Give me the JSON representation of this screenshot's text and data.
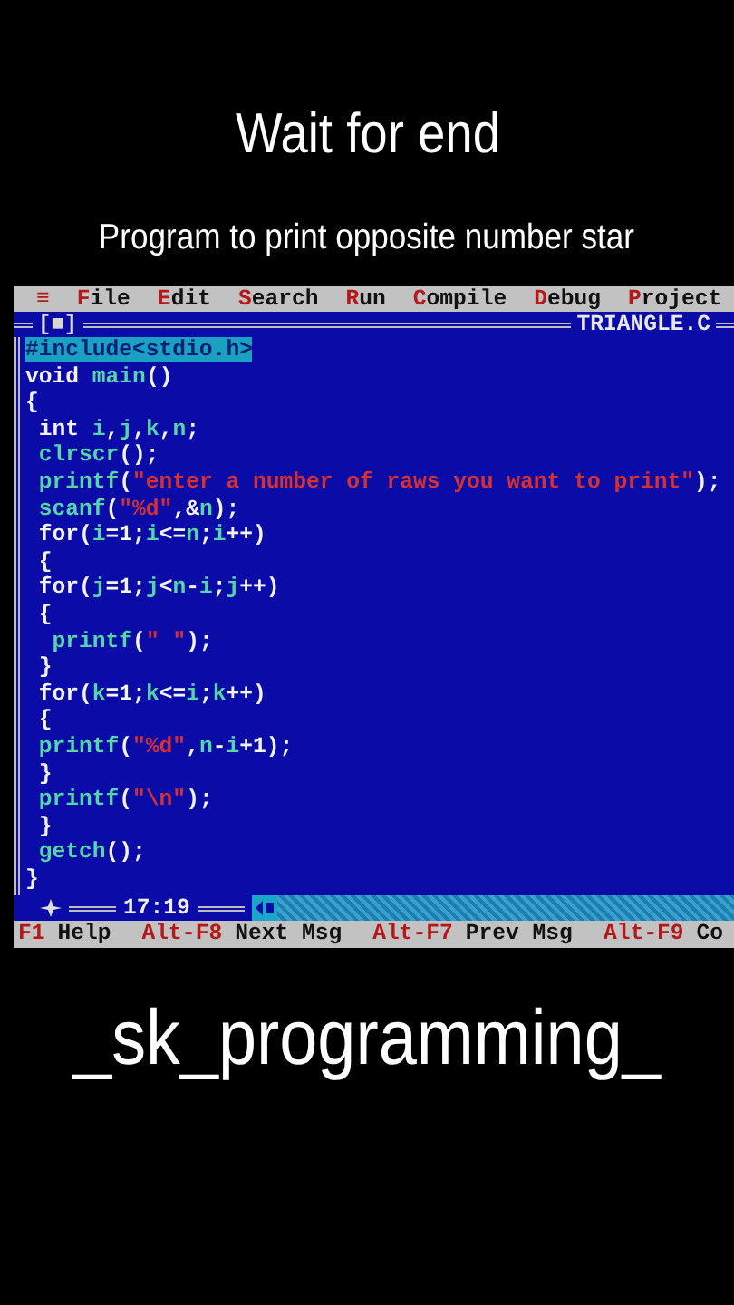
{
  "captions": {
    "heading": "Wait for end",
    "subheading": "Program to print opposite number star"
  },
  "menu": [
    {
      "label": "≡",
      "kind": "system"
    },
    {
      "label": "File",
      "kind": "menu"
    },
    {
      "label": "Edit",
      "kind": "menu"
    },
    {
      "label": "Search",
      "kind": "menu"
    },
    {
      "label": "Run",
      "kind": "menu"
    },
    {
      "label": "Compile",
      "kind": "menu"
    },
    {
      "label": "Debug",
      "kind": "menu"
    },
    {
      "label": "Project",
      "kind": "menu"
    }
  ],
  "editor": {
    "close_box": "[■]",
    "title": "TRIANGLE.C",
    "position": "17:19",
    "lines": [
      [
        {
          "kind": "directive",
          "text": "#include<stdio.h>"
        }
      ],
      [
        {
          "kind": "plain",
          "text": "void "
        },
        {
          "kind": "ident",
          "text": "main"
        },
        {
          "kind": "plain",
          "text": "()"
        }
      ],
      [
        {
          "kind": "plain",
          "text": "{"
        }
      ],
      [
        {
          "kind": "plain",
          "text": " int "
        },
        {
          "kind": "ident",
          "text": "i"
        },
        {
          "kind": "plain",
          "text": ","
        },
        {
          "kind": "ident",
          "text": "j"
        },
        {
          "kind": "plain",
          "text": ","
        },
        {
          "kind": "ident",
          "text": "k"
        },
        {
          "kind": "plain",
          "text": ","
        },
        {
          "kind": "ident",
          "text": "n"
        },
        {
          "kind": "plain",
          "text": ";"
        }
      ],
      [
        {
          "kind": "ident",
          "text": " clrscr"
        },
        {
          "kind": "plain",
          "text": "();"
        }
      ],
      [
        {
          "kind": "ident",
          "text": " printf"
        },
        {
          "kind": "plain",
          "text": "("
        },
        {
          "kind": "string",
          "text": "\"enter a number of raws you want to print\""
        },
        {
          "kind": "plain",
          "text": ");"
        }
      ],
      [
        {
          "kind": "ident",
          "text": " scanf"
        },
        {
          "kind": "plain",
          "text": "("
        },
        {
          "kind": "string",
          "text": "\"%d\""
        },
        {
          "kind": "plain",
          "text": ",&"
        },
        {
          "kind": "ident",
          "text": "n"
        },
        {
          "kind": "plain",
          "text": ");"
        }
      ],
      [
        {
          "kind": "plain",
          "text": " for("
        },
        {
          "kind": "ident",
          "text": "i"
        },
        {
          "kind": "plain",
          "text": "=1;"
        },
        {
          "kind": "ident",
          "text": "i"
        },
        {
          "kind": "plain",
          "text": "<="
        },
        {
          "kind": "ident",
          "text": "n"
        },
        {
          "kind": "plain",
          "text": ";"
        },
        {
          "kind": "ident",
          "text": "i"
        },
        {
          "kind": "plain",
          "text": "++)"
        }
      ],
      [
        {
          "kind": "plain",
          "text": " {"
        }
      ],
      [
        {
          "kind": "plain",
          "text": " for("
        },
        {
          "kind": "ident",
          "text": "j"
        },
        {
          "kind": "plain",
          "text": "=1;"
        },
        {
          "kind": "ident",
          "text": "j"
        },
        {
          "kind": "plain",
          "text": "<"
        },
        {
          "kind": "ident",
          "text": "n"
        },
        {
          "kind": "plain",
          "text": "-"
        },
        {
          "kind": "ident",
          "text": "i"
        },
        {
          "kind": "plain",
          "text": ";"
        },
        {
          "kind": "ident",
          "text": "j"
        },
        {
          "kind": "plain",
          "text": "++)"
        }
      ],
      [
        {
          "kind": "plain",
          "text": " {"
        }
      ],
      [
        {
          "kind": "ident",
          "text": "  printf"
        },
        {
          "kind": "plain",
          "text": "("
        },
        {
          "kind": "string",
          "text": "\" \""
        },
        {
          "kind": "plain",
          "text": ");"
        }
      ],
      [
        {
          "kind": "plain",
          "text": " }"
        }
      ],
      [
        {
          "kind": "plain",
          "text": " for("
        },
        {
          "kind": "ident",
          "text": "k"
        },
        {
          "kind": "plain",
          "text": "=1;"
        },
        {
          "kind": "ident",
          "text": "k"
        },
        {
          "kind": "plain",
          "text": "<="
        },
        {
          "kind": "ident",
          "text": "i"
        },
        {
          "kind": "plain",
          "text": ";"
        },
        {
          "kind": "ident",
          "text": "k"
        },
        {
          "kind": "plain",
          "text": "++)"
        }
      ],
      [
        {
          "kind": "plain",
          "text": " {"
        }
      ],
      [
        {
          "kind": "ident",
          "text": " printf"
        },
        {
          "kind": "plain",
          "text": "("
        },
        {
          "kind": "string",
          "text": "\"%d\""
        },
        {
          "kind": "plain",
          "text": ","
        },
        {
          "kind": "ident",
          "text": "n"
        },
        {
          "kind": "plain",
          "text": "-"
        },
        {
          "kind": "ident",
          "text": "i"
        },
        {
          "kind": "plain",
          "text": "+1);"
        }
      ],
      [
        {
          "kind": "plain",
          "text": " }"
        }
      ],
      [
        {
          "kind": "ident",
          "text": " printf"
        },
        {
          "kind": "plain",
          "text": "("
        },
        {
          "kind": "string",
          "text": "\"\\n\""
        },
        {
          "kind": "plain",
          "text": ");"
        }
      ],
      [
        {
          "kind": "plain",
          "text": " }"
        }
      ],
      [
        {
          "kind": "ident",
          "text": " getch"
        },
        {
          "kind": "plain",
          "text": "();"
        }
      ],
      [
        {
          "kind": "plain",
          "text": "}"
        }
      ]
    ]
  },
  "status_bar": [
    {
      "key": "F1",
      "label": "Help"
    },
    {
      "key": "Alt-F8",
      "label": "Next Msg"
    },
    {
      "key": "Alt-F7",
      "label": "Prev Msg"
    },
    {
      "key": "Alt-F9",
      "label": "Co"
    }
  ],
  "footer": {
    "channel": "_sk_programming_"
  }
}
